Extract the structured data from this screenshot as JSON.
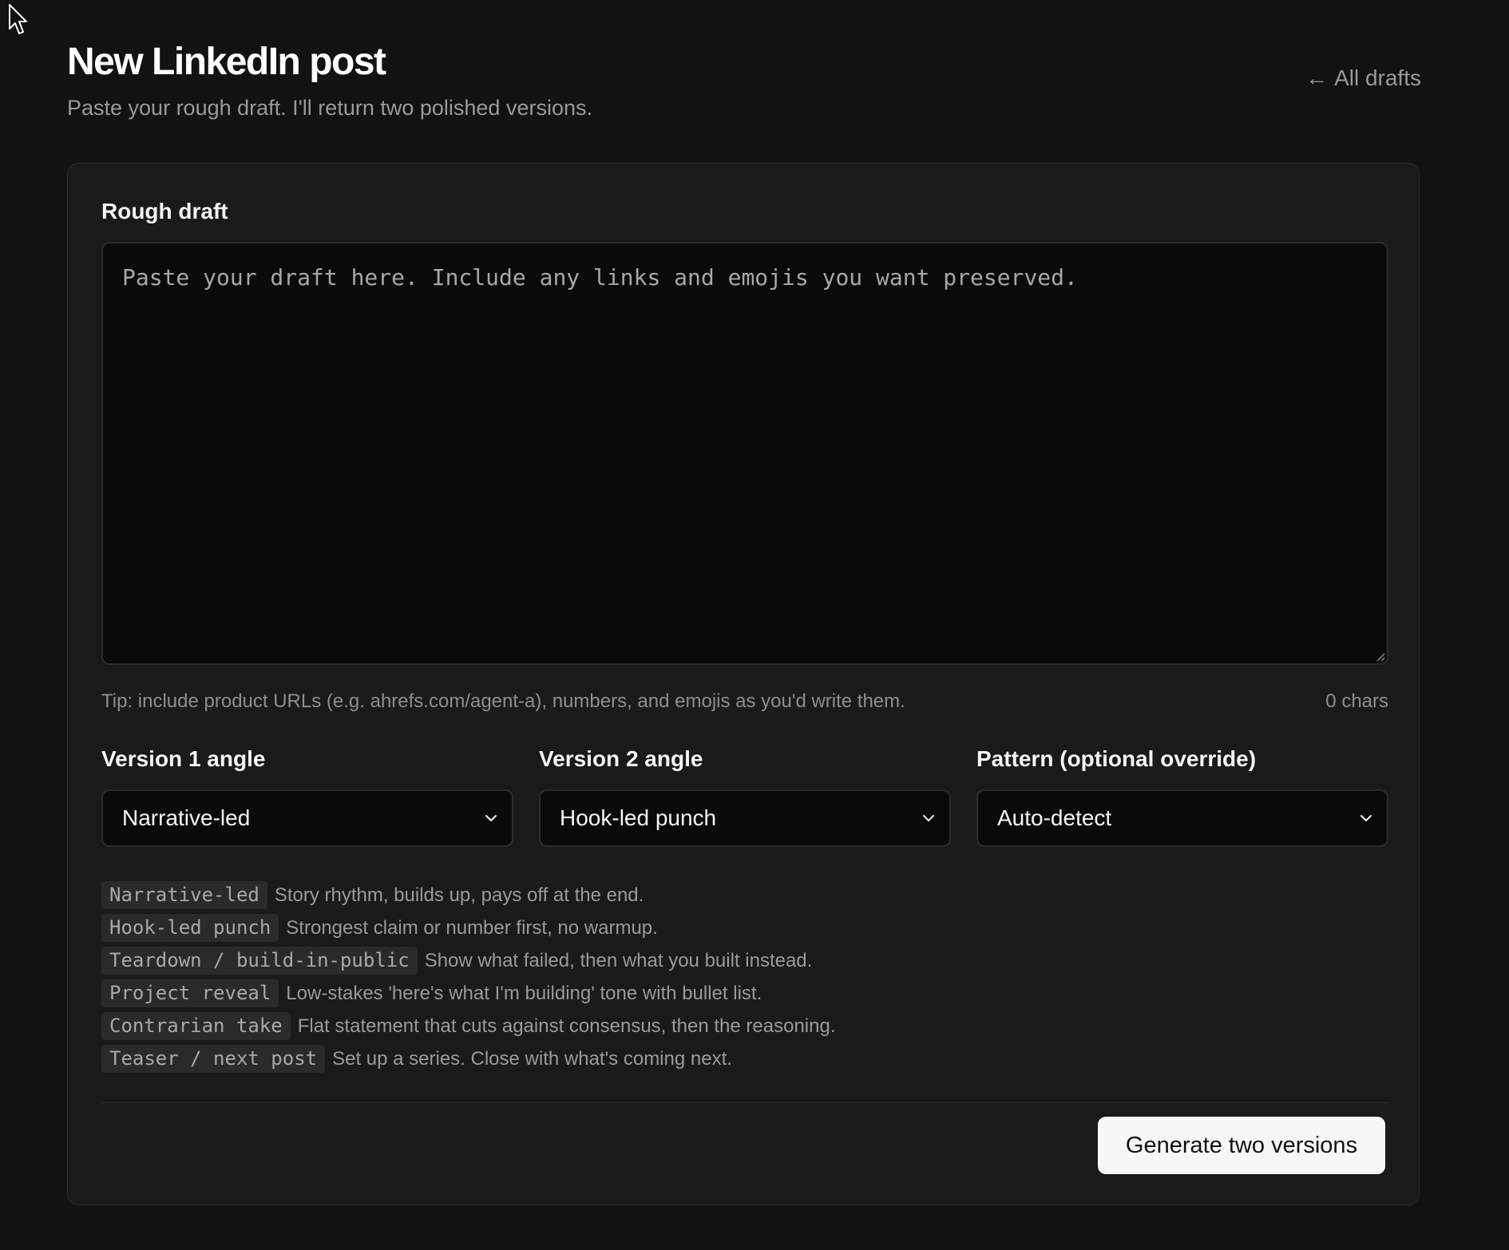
{
  "header": {
    "title": "New LinkedIn post",
    "subtitle": "Paste your rough draft. I'll return two polished versions.",
    "back_link": "All drafts",
    "back_arrow": "←"
  },
  "draft": {
    "label": "Rough draft",
    "value": "",
    "placeholder": "Paste your draft here. Include any links and emojis you want preserved.",
    "tip": "Tip: include product URLs (e.g. ahrefs.com/agent-a), numbers, and emojis as you'd write them.",
    "char_count": "0 chars"
  },
  "selects": {
    "version1": {
      "label": "Version 1 angle",
      "value": "Narrative-led"
    },
    "version2": {
      "label": "Version 2 angle",
      "value": "Hook-led punch"
    },
    "pattern": {
      "label": "Pattern (optional override)",
      "value": "Auto-detect"
    }
  },
  "angles": [
    {
      "name": "Narrative-led",
      "description": "Story rhythm, builds up, pays off at the end."
    },
    {
      "name": "Hook-led punch",
      "description": "Strongest claim or number first, no warmup."
    },
    {
      "name": "Teardown / build-in-public",
      "description": "Show what failed, then what you built instead."
    },
    {
      "name": "Project reveal",
      "description": "Low-stakes 'here's what I'm building' tone with bullet list."
    },
    {
      "name": "Contrarian take",
      "description": "Flat statement that cuts against consensus, then the reasoning."
    },
    {
      "name": "Teaser / next post",
      "description": "Set up a series. Close with what's coming next."
    }
  ],
  "actions": {
    "generate_label": "Generate two versions"
  },
  "icons": {
    "cursor": "mouse-pointer-icon",
    "chevron": "chevron-down-icon",
    "arrow": "arrow-left-icon"
  },
  "colors": {
    "background": "#121212",
    "card": "#1a1a1a",
    "input": "#0a0a0a",
    "border": "#2c2c2c",
    "muted_text": "#9a9a9a",
    "button_bg": "#f7f7f7",
    "button_text": "#111111"
  }
}
